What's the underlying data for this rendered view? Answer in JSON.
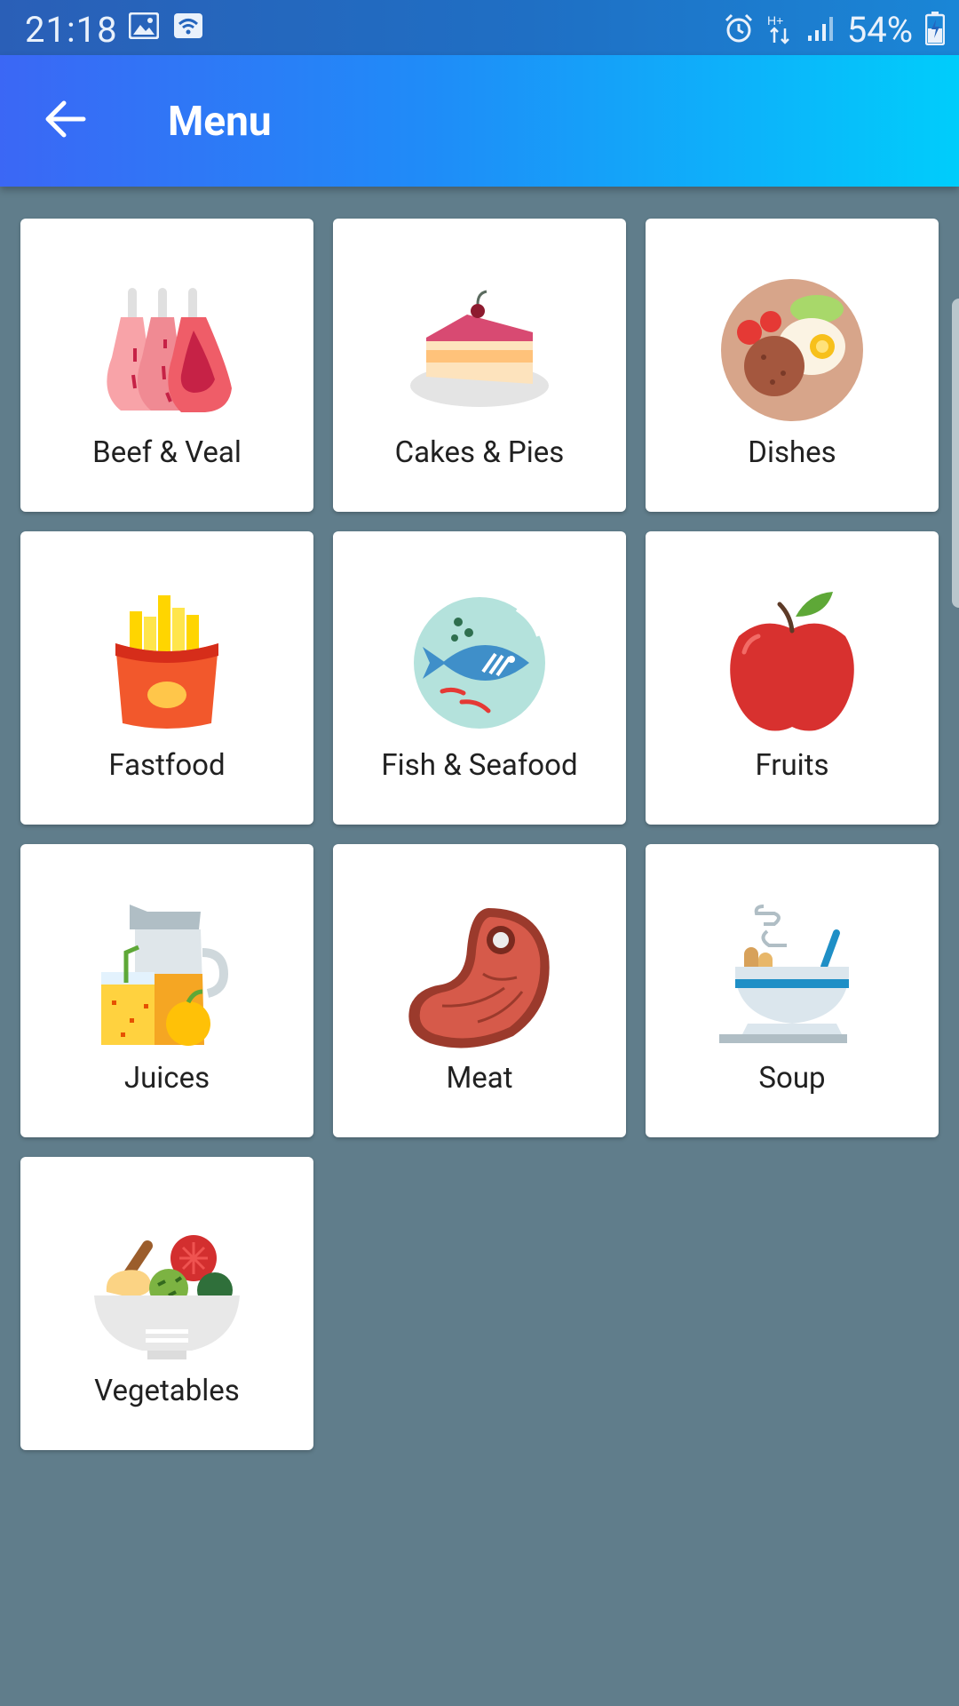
{
  "status_bar": {
    "time": "21:18",
    "battery": "54%",
    "left_icons": [
      "image-icon",
      "wifi-box-icon"
    ],
    "right_icons": [
      "alarm-icon",
      "data-arrows-icon",
      "signal-icon",
      "battery-charging-icon"
    ]
  },
  "app_bar": {
    "title": "Menu",
    "back_icon": "arrow-back-icon"
  },
  "categories": [
    {
      "label": "Beef & Veal",
      "icon": "beef-veal-icon"
    },
    {
      "label": "Cakes & Pies",
      "icon": "cake-icon"
    },
    {
      "label": "Dishes",
      "icon": "dish-plate-icon"
    },
    {
      "label": "Fastfood",
      "icon": "fries-icon"
    },
    {
      "label": "Fish & Seafood",
      "icon": "fish-icon"
    },
    {
      "label": "Fruits",
      "icon": "apple-icon"
    },
    {
      "label": "Juices",
      "icon": "juice-icon"
    },
    {
      "label": "Meat",
      "icon": "steak-icon"
    },
    {
      "label": "Soup",
      "icon": "soup-icon"
    },
    {
      "label": "Vegetables",
      "icon": "salad-icon"
    }
  ],
  "colors": {
    "background": "#607d8b",
    "app_bar_start": "#3b67f5",
    "app_bar_end": "#00cdfb",
    "card": "#ffffff"
  }
}
